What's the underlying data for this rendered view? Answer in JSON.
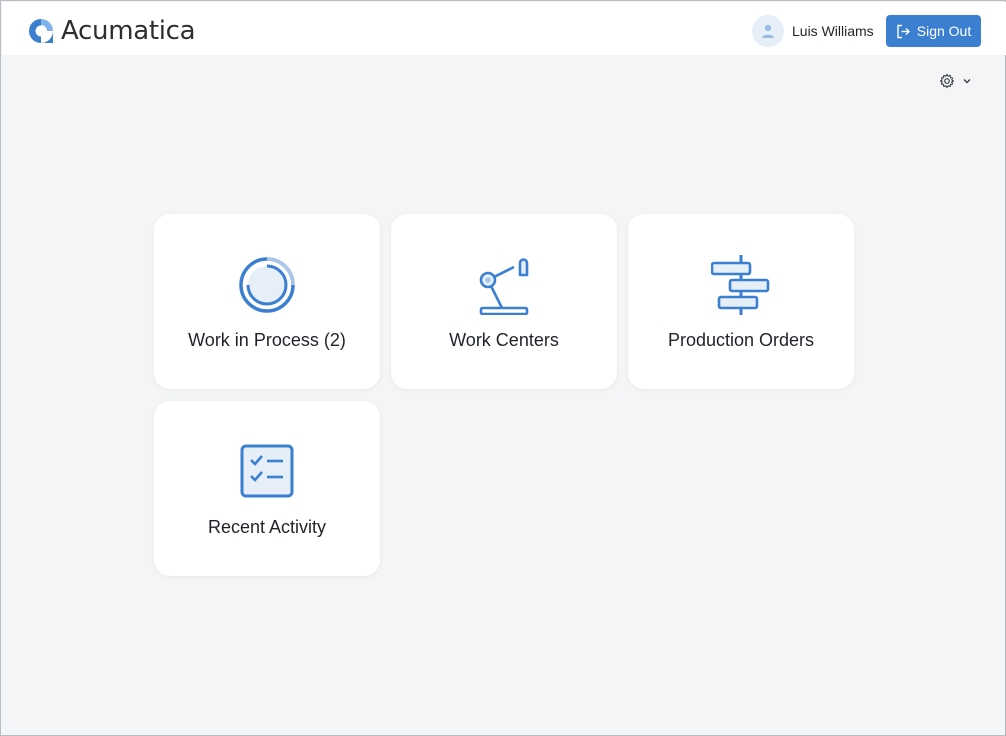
{
  "app": {
    "brand_name": "Acumatica"
  },
  "header": {
    "user_name": "Luis Williams",
    "signout_label": "Sign Out"
  },
  "colors": {
    "accent": "#3a7fd0",
    "icon_blue": "#3a7fd0",
    "background": "#f4f5f7",
    "tile": "#ffffff"
  },
  "icons": {
    "avatar": "user-icon",
    "signout": "sign-out-icon",
    "settings": "gear-icon",
    "settings_caret": "chevron-down-icon"
  },
  "tiles": [
    {
      "label": "Work in Process (2)",
      "icon": "progress-circle-icon"
    },
    {
      "label": "Work Centers",
      "icon": "robot-arm-icon"
    },
    {
      "label": "Production Orders",
      "icon": "gantt-icon"
    },
    {
      "label": "Recent Activity",
      "icon": "checklist-icon"
    }
  ]
}
